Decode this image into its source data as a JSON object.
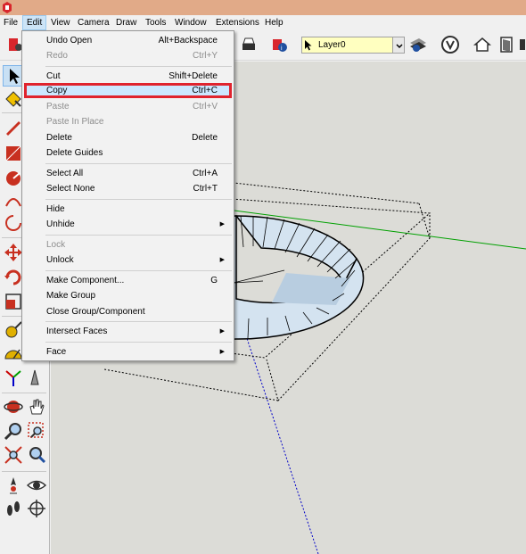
{
  "menubar": {
    "items": [
      {
        "key": "file",
        "label": "File"
      },
      {
        "key": "edit",
        "label": "Edit"
      },
      {
        "key": "view",
        "label": "View"
      },
      {
        "key": "camera",
        "label": "Camera"
      },
      {
        "key": "draw",
        "label": "Draw"
      },
      {
        "key": "tools",
        "label": "Tools"
      },
      {
        "key": "window",
        "label": "Window"
      },
      {
        "key": "extensions",
        "label": "Extensions"
      },
      {
        "key": "help",
        "label": "Help"
      }
    ],
    "open_menu": "edit"
  },
  "toolbar": {
    "layer_current": "Layer0"
  },
  "edit_menu": {
    "items": [
      {
        "label": "Undo Open",
        "shortcut": "Alt+Backspace",
        "enabled": true
      },
      {
        "label": "Redo",
        "shortcut": "Ctrl+Y",
        "enabled": false
      },
      {
        "label": "Cut",
        "shortcut": "Shift+Delete",
        "enabled": true
      },
      {
        "label": "Copy",
        "shortcut": "Ctrl+C",
        "enabled": true,
        "highlighted": true
      },
      {
        "label": "Paste",
        "shortcut": "Ctrl+V",
        "enabled": false
      },
      {
        "label": "Paste In Place",
        "shortcut": "",
        "enabled": false
      },
      {
        "label": "Delete",
        "shortcut": "Delete",
        "enabled": true
      },
      {
        "label": "Delete Guides",
        "shortcut": "",
        "enabled": true
      },
      {
        "label": "Select All",
        "shortcut": "Ctrl+A",
        "enabled": true
      },
      {
        "label": "Select None",
        "shortcut": "Ctrl+T",
        "enabled": true
      },
      {
        "label": "Hide",
        "shortcut": "",
        "enabled": true
      },
      {
        "label": "Unhide",
        "shortcut": "",
        "enabled": true,
        "submenu": true
      },
      {
        "label": "Lock",
        "shortcut": "",
        "enabled": false
      },
      {
        "label": "Unlock",
        "shortcut": "",
        "enabled": true,
        "submenu": true
      },
      {
        "label": "Make Component...",
        "shortcut": "G",
        "enabled": true
      },
      {
        "label": "Make Group",
        "shortcut": "",
        "enabled": true
      },
      {
        "label": "Close Group/Component",
        "shortcut": "",
        "enabled": true
      },
      {
        "label": "Intersect Faces",
        "shortcut": "",
        "enabled": true,
        "submenu": true
      },
      {
        "label": "Face",
        "shortcut": "",
        "enabled": true,
        "submenu": true
      }
    ]
  },
  "colors": {
    "titlebar": "#e1aa88",
    "menu_highlight_border": "#e0242e",
    "menu_highlight_fill": "#cce8ff",
    "viewport_bg": "#dcdcd7",
    "ring_face": "#d4e3f0",
    "green_axis": "#00a000",
    "blue_axis": "#0000c8",
    "red_axis": "#c80000"
  }
}
